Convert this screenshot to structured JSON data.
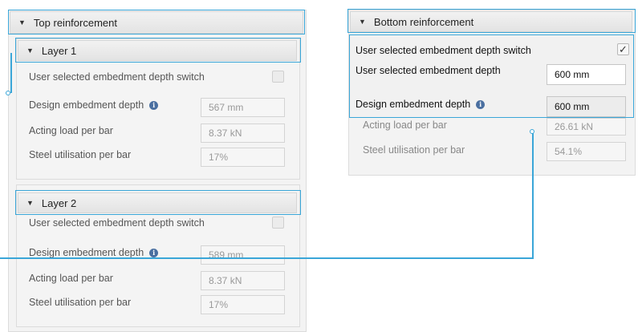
{
  "top_panel": {
    "title": "Top reinforcement",
    "layer1": {
      "title": "Layer 1",
      "switch_label": "User selected embedment depth switch",
      "embedment_label": "Design embedment depth",
      "embedment_value": "567 mm",
      "load_label": "Acting load per bar",
      "load_value": "8.37 kN",
      "util_label": "Steel utilisation per bar",
      "util_value": "17%"
    },
    "layer2": {
      "title": "Layer 2",
      "switch_label": "User selected embedment depth switch",
      "embedment_label": "Design embedment depth",
      "embedment_value": "589 mm",
      "load_label": "Acting load per bar",
      "load_value": "8.37 kN",
      "util_label": "Steel utilisation per bar",
      "util_value": "17%"
    }
  },
  "bottom_panel": {
    "title": "Bottom reinforcement",
    "switch_label": "User selected embedment depth switch",
    "switch_checked": true,
    "switch_mark": "✓",
    "user_depth_label": "User selected embedment depth",
    "user_depth_value": "600 mm",
    "embedment_label": "Design embedment depth",
    "embedment_value": "600 mm",
    "load_label": "Acting load per bar",
    "load_value": "26.61 kN",
    "util_label": "Steel utilisation per bar",
    "util_value": "54.1%"
  },
  "icons": {
    "caret": "▼",
    "info": "i"
  },
  "colors": {
    "highlight": "#3aa6d8",
    "info_icon": "#4a6fa0"
  }
}
